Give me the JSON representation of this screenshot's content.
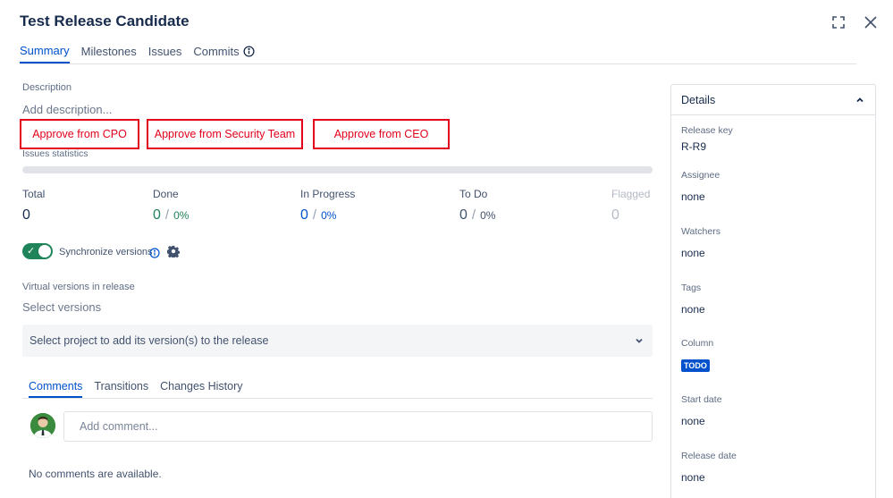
{
  "header": {
    "title": "Test Release Candidate"
  },
  "icons": {
    "expand": "expand-icon",
    "close": "close-icon"
  },
  "tabs": [
    {
      "label": "Summary",
      "active": true
    },
    {
      "label": "Milestones"
    },
    {
      "label": "Issues"
    },
    {
      "label": "Commits"
    }
  ],
  "description": {
    "label": "Description",
    "placeholder": "Add description..."
  },
  "approvals": [
    "Approve from CPO",
    "Approve from Security Team",
    "Approve from CEO"
  ],
  "issues_statistics": {
    "label": "Issues statistics",
    "total": {
      "label": "Total",
      "value": "0"
    },
    "done": {
      "label": "Done",
      "value": "0",
      "percent": "0%"
    },
    "in_progress": {
      "label": "In Progress",
      "value": "0",
      "percent": "0%"
    },
    "todo": {
      "label": "To Do",
      "value": "0",
      "percent": "0%"
    },
    "flagged": {
      "label": "Flagged",
      "value": "0"
    },
    "separator": "/"
  },
  "sync": {
    "label": "Synchronize versions",
    "enabled": true
  },
  "virtual_versions": {
    "label": "Virtual versions in release",
    "placeholder": "Select versions",
    "select_project": "Select project to add its version(s) to the release"
  },
  "comment_tabs": [
    {
      "label": "Comments",
      "active": true
    },
    {
      "label": "Transitions"
    },
    {
      "label": "Changes History"
    }
  ],
  "comments": {
    "placeholder": "Add comment...",
    "empty": "No comments are available."
  },
  "details": {
    "title": "Details",
    "release_key": {
      "label": "Release key",
      "value": "R-R9"
    },
    "assignee": {
      "label": "Assignee",
      "value": "none"
    },
    "watchers": {
      "label": "Watchers",
      "value": "none"
    },
    "tags": {
      "label": "Tags",
      "value": "none"
    },
    "column": {
      "label": "Column",
      "value": "TODO"
    },
    "start_date": {
      "label": "Start date",
      "value": "none"
    },
    "release_date": {
      "label": "Release date",
      "value": "none"
    }
  },
  "colors": {
    "accent": "#0052cc",
    "done_green": "#1f845a",
    "approve_red": "#e3001b",
    "toggle_green": "#1f845a"
  }
}
